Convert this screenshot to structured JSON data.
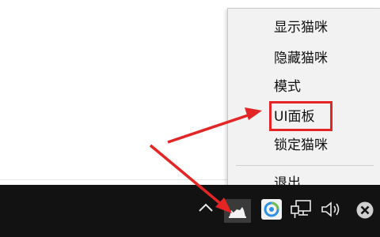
{
  "context_menu": {
    "items": [
      {
        "label": "显示猫咪"
      },
      {
        "label": "隐藏猫咪"
      },
      {
        "label": "模式"
      },
      {
        "label": "UI面板",
        "highlighted": true
      },
      {
        "label": "锁定猫咪"
      },
      {
        "label": "退出"
      }
    ]
  },
  "annotation": {
    "color": "#e32525"
  },
  "taskbar": {
    "background": "#121212",
    "tray_icons": [
      "chevron-up-icon",
      "cat-tray-icon",
      "sync-app-icon",
      "network-icon",
      "speaker-icon",
      "close-circle-icon"
    ]
  }
}
